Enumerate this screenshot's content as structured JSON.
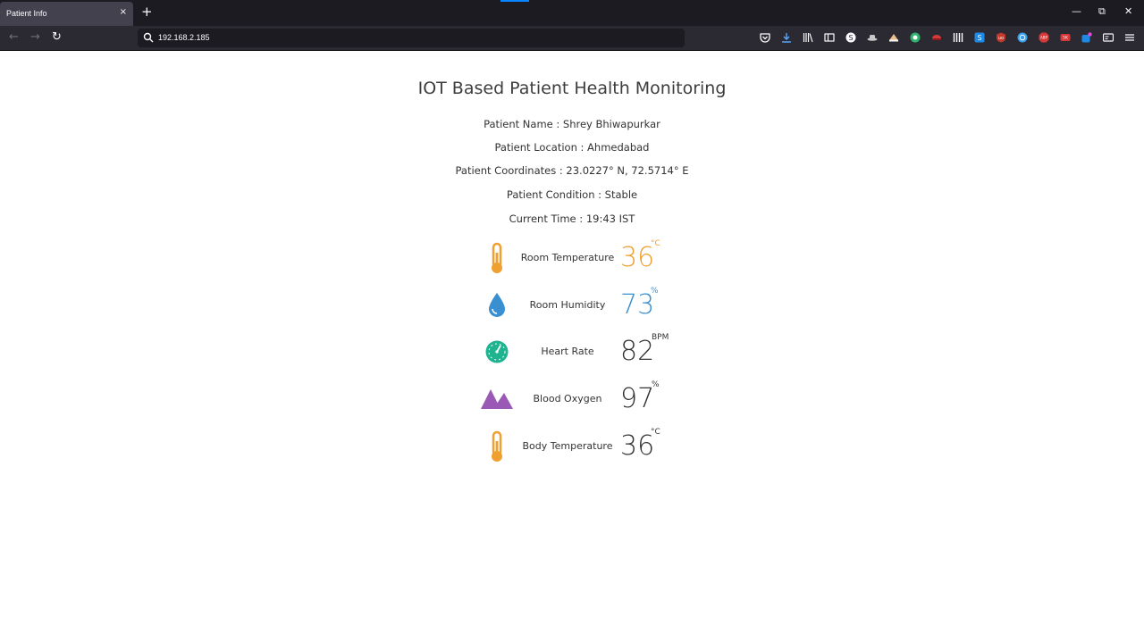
{
  "browser": {
    "tab_title": "Patient Info",
    "tab_close": "×",
    "new_tab": "+",
    "url": "192.168.2.185",
    "back": "←",
    "forward": "→",
    "reload": "↻",
    "minimize": "—",
    "restore": "⧉",
    "close": "✕"
  },
  "page": {
    "title": "IOT Based Patient Health Monitoring",
    "patient_name": "Patient Name : Shrey Bhiwapurkar",
    "patient_location": "Patient Location : Ahmedabad",
    "patient_coordinates": "Patient Coordinates : 23.0227° N, 72.5714° E",
    "patient_condition": "Patient Condition : Stable",
    "current_time": "Current Time : 19:43 IST"
  },
  "metrics": [
    {
      "label": "Room Temperature",
      "value": "36",
      "unit": "°C",
      "color": "#f0a030",
      "icon": "thermometer-icon"
    },
    {
      "label": "Room Humidity",
      "value": "73",
      "unit": "%",
      "color": "#3a8fd1",
      "icon": "water-drop-icon"
    },
    {
      "label": "Heart Rate",
      "value": "82",
      "unit": "BPM",
      "color": "#333333",
      "icon": "gauge-icon"
    },
    {
      "label": "Blood Oxygen",
      "value": "97",
      "unit": "%",
      "color": "#333333",
      "icon": "mountain-icon"
    },
    {
      "label": "Body Temperature",
      "value": "36",
      "unit": "°C",
      "color": "#333333",
      "icon": "thermometer-icon"
    }
  ],
  "colors": {
    "thermometer": "#f0a030",
    "drop": "#3a8fd1",
    "gauge": "#1fb38f",
    "mountain": "#9b59b6"
  }
}
